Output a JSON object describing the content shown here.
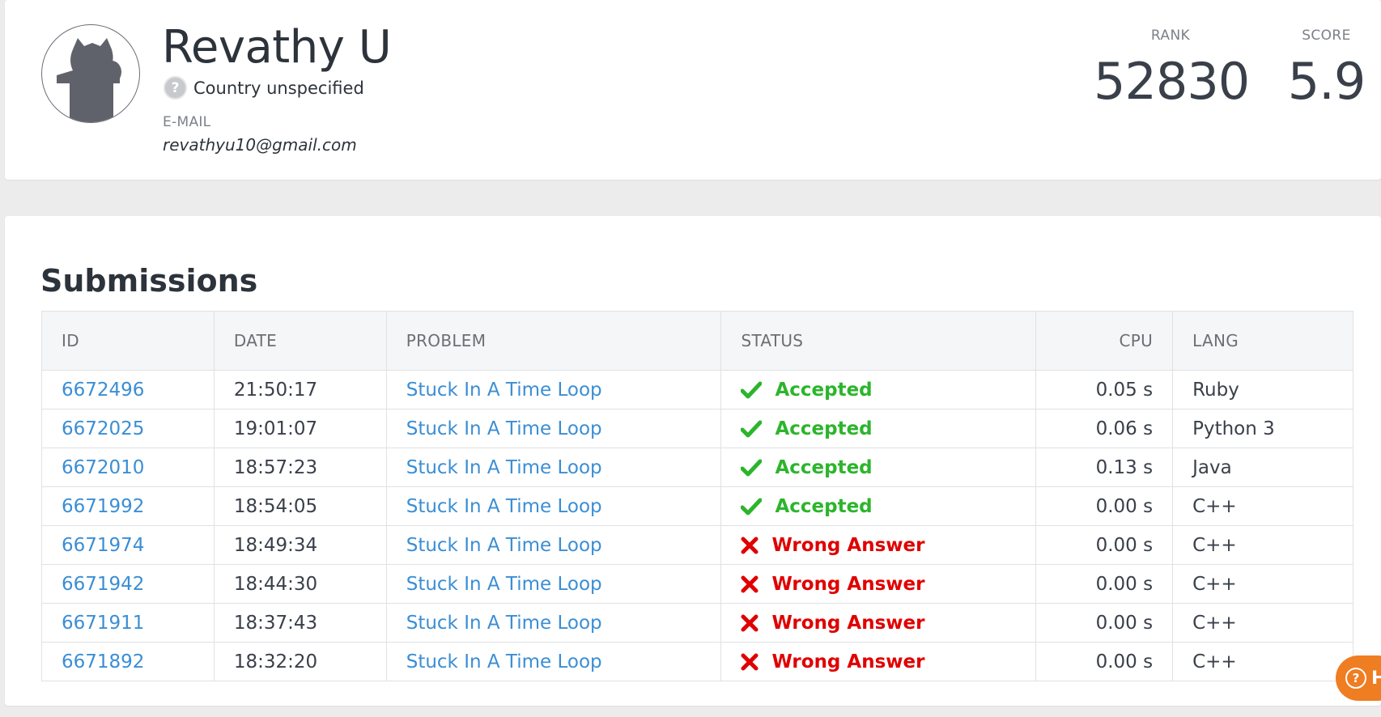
{
  "profile": {
    "name": "Revathy U",
    "country": "Country unspecified",
    "email_label": "E-MAIL",
    "email": "revathyu10@gmail.com",
    "avatar_icon": "kattis-cat-avatar-icon",
    "country_icon": "question-mark-icon"
  },
  "stats": {
    "rank_label": "RANK",
    "rank_value": "52830",
    "score_label": "SCORE",
    "score_value": "5.9"
  },
  "submissions": {
    "title": "Submissions",
    "columns": [
      "ID",
      "DATE",
      "PROBLEM",
      "STATUS",
      "CPU",
      "LANG"
    ],
    "rows": [
      {
        "id": "6672496",
        "date": "21:50:17",
        "problem": "Stuck In A Time Loop",
        "status": "Accepted",
        "status_type": "accepted",
        "cpu": "0.05 s",
        "lang": "Ruby"
      },
      {
        "id": "6672025",
        "date": "19:01:07",
        "problem": "Stuck In A Time Loop",
        "status": "Accepted",
        "status_type": "accepted",
        "cpu": "0.06 s",
        "lang": "Python 3"
      },
      {
        "id": "6672010",
        "date": "18:57:23",
        "problem": "Stuck In A Time Loop",
        "status": "Accepted",
        "status_type": "accepted",
        "cpu": "0.13 s",
        "lang": "Java"
      },
      {
        "id": "6671992",
        "date": "18:54:05",
        "problem": "Stuck In A Time Loop",
        "status": "Accepted",
        "status_type": "accepted",
        "cpu": "0.00 s",
        "lang": "C++"
      },
      {
        "id": "6671974",
        "date": "18:49:34",
        "problem": "Stuck In A Time Loop",
        "status": "Wrong Answer",
        "status_type": "wrong",
        "cpu": "0.00 s",
        "lang": "C++"
      },
      {
        "id": "6671942",
        "date": "18:44:30",
        "problem": "Stuck In A Time Loop",
        "status": "Wrong Answer",
        "status_type": "wrong",
        "cpu": "0.00 s",
        "lang": "C++"
      },
      {
        "id": "6671911",
        "date": "18:37:43",
        "problem": "Stuck In A Time Loop",
        "status": "Wrong Answer",
        "status_type": "wrong",
        "cpu": "0.00 s",
        "lang": "C++"
      },
      {
        "id": "6671892",
        "date": "18:32:20",
        "problem": "Stuck In A Time Loop",
        "status": "Wrong Answer",
        "status_type": "wrong",
        "cpu": "0.00 s",
        "lang": "C++"
      }
    ]
  },
  "help_widget": {
    "label": "H",
    "icon": "question-circle-icon"
  },
  "colors": {
    "link": "#3b8ed4",
    "accepted": "#2cb52c",
    "wrong": "#e00000",
    "help_button": "#ef7d22"
  }
}
